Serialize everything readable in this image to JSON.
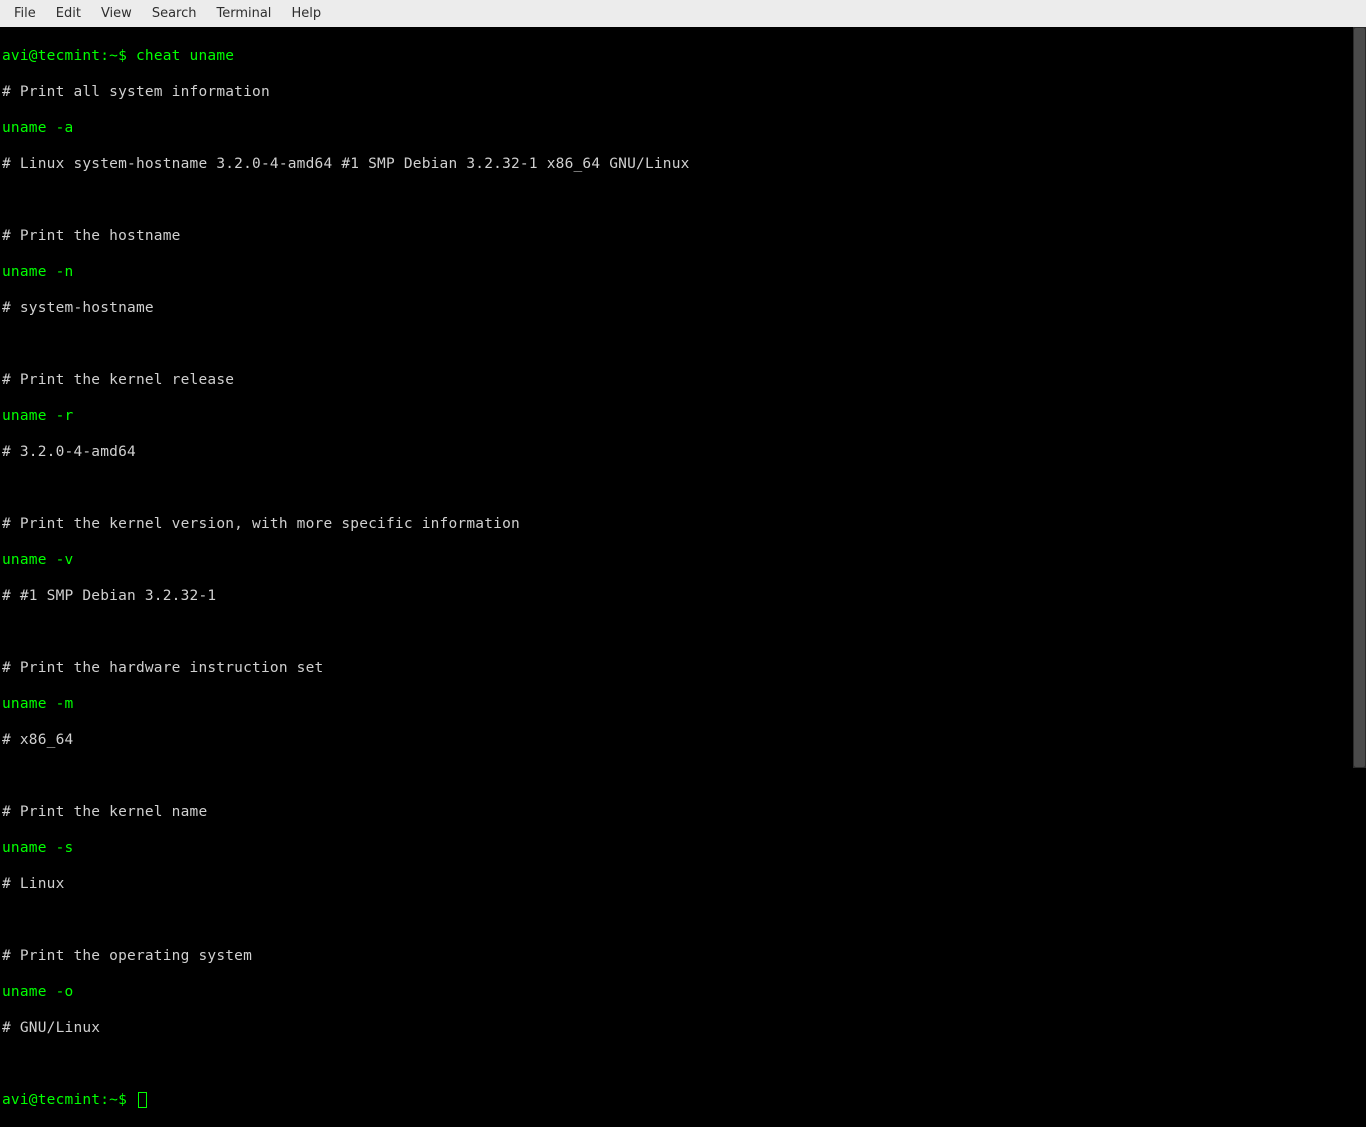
{
  "menubar": {
    "items": [
      "File",
      "Edit",
      "View",
      "Search",
      "Terminal",
      "Help"
    ]
  },
  "terminal": {
    "prompt1": "avi@tecmint:~$ ",
    "command1": "cheat uname",
    "lines": [
      {
        "cls": "white",
        "text": "# Print all system information"
      },
      {
        "cls": "green",
        "text": "uname -a"
      },
      {
        "cls": "white",
        "text": "# Linux system-hostname 3.2.0-4-amd64 #1 SMP Debian 3.2.32-1 x86_64 GNU/Linux"
      },
      {
        "cls": "white",
        "text": ""
      },
      {
        "cls": "white",
        "text": "# Print the hostname"
      },
      {
        "cls": "green",
        "text": "uname -n"
      },
      {
        "cls": "white",
        "text": "# system-hostname"
      },
      {
        "cls": "white",
        "text": ""
      },
      {
        "cls": "white",
        "text": "# Print the kernel release"
      },
      {
        "cls": "green",
        "text": "uname -r"
      },
      {
        "cls": "white",
        "text": "# 3.2.0-4-amd64"
      },
      {
        "cls": "white",
        "text": ""
      },
      {
        "cls": "white",
        "text": "# Print the kernel version, with more specific information"
      },
      {
        "cls": "green",
        "text": "uname -v"
      },
      {
        "cls": "white",
        "text": "# #1 SMP Debian 3.2.32-1"
      },
      {
        "cls": "white",
        "text": ""
      },
      {
        "cls": "white",
        "text": "# Print the hardware instruction set"
      },
      {
        "cls": "green",
        "text": "uname -m"
      },
      {
        "cls": "white",
        "text": "# x86_64"
      },
      {
        "cls": "white",
        "text": ""
      },
      {
        "cls": "white",
        "text": "# Print the kernel name"
      },
      {
        "cls": "green",
        "text": "uname -s"
      },
      {
        "cls": "white",
        "text": "# Linux"
      },
      {
        "cls": "white",
        "text": ""
      },
      {
        "cls": "white",
        "text": "# Print the operating system"
      },
      {
        "cls": "green",
        "text": "uname -o"
      },
      {
        "cls": "white",
        "text": "# GNU/Linux"
      },
      {
        "cls": "white",
        "text": ""
      }
    ],
    "prompt2": "avi@tecmint:~$ "
  }
}
